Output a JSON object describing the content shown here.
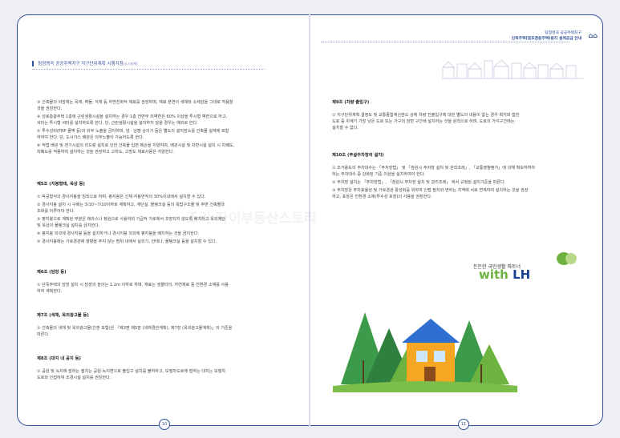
{
  "left_page": {
    "header_title": "탕정명곡 공공주택지구 지구단위계획 시행지침",
    "header_suffix": "(도시설계)",
    "page_number": "10",
    "items_top": [
      "③  건축물의 외장재는 목재, 벽돌, 석재 등 자연친화적 재료를 권장하며, 재료 본연의 색채와 소재감을 그대로 적용할",
      "      것을 권장한다.",
      "④  성로층층주택 1층에 근린생활시설을 설치하는 경우 1층 전면부 외벽면은 60% 이상을 투시형 벽면으로 하고,",
      "      셔터는 투시형 셔터를 설치하도록 한다. 단, 근린생활시설을 설치하지 않을 경우는 예외로 한다.",
      "⑤  투수성비(FRP 물벽 등)의 외부 노출을 금지하며, 넘 · 남향 상의가 등은 별도의 설치장소를 건축물 설계에 포함",
      "      하여야 한다. 단, 도시가스 배관은 외부노출이 가능하도록 한다.",
      "⑥  적법 배관 및 전기시설의 리드랑 설치로 인한 건축물 입면 훼손을 지양하며, 배관시설 및 차면시설 설치 시 차폐도,",
      "      차폐도를 적용하여 설치하는 것을 권장하고 고하도, 고명도 채료사용은 지양한다."
    ],
    "art5_title": "제5조 (지붕형태, 옥상 등)",
    "art5_items": [
      "①  박공형식의 경사지붕을 임직으로 하며, 평지붕은 신체 지붕면적의 30%이내에서 설치할 수 있다.",
      "②  경사지붕 설치 시 구배는 3/10~7/10이하로 계획하고, 계단실, 물탱크실 등의 옥탑구조물 및 주변 건축물과",
      "      조화를 이루어야 한다.",
      "③  평지붕으로 계획된 부분은 테라스나 정원으로 사용하되 가급적 가로에서 조망되지 않도록 배치하고 옥외계단",
      "      및 옥상의 물탱크실 설치를 금지한다.",
      "④  평지붕 외곽에 경사지붕 등을 설치하거나 경사지붕 외곽에 평지붕을 배치하는 것을 금지한다.",
      "⑤  경사지붕에는 가로경관에 영향을 주지 않는 범위 내에서 실외기, 안테나, 물탱크실 등을 설치할 수 있다."
    ],
    "art6_title": "제6조 (담장 등)",
    "art6_items": [
      "①  단독주택의 담장 설치 시 담장의 높이는 1.2m 이하로 하며, 재료는 생울타리, 자연재료 등 친환경 소재를 사용",
      "      하여 계획한다."
    ],
    "art7_title": "제7조 (색채, 옥외광고물 등)",
    "art7_items": [
      "①  건축물의 색채 및 옥외광고물(간판 포함)은 「제3편 제5장 (색채경관계획), 제7장 (옥외광고물계획)」의 기준을",
      "      따른다."
    ],
    "art8_title": "제8조 (대지 내 공지 등)",
    "art8_items": [
      "①  공원 및 녹지에 접하는 필지는 공원·녹지변으로 출입구 설치를 불허하고, 보행자도로에 접하는 대지는 보행자",
      "      도로와 인접하여 조경시설 설치를 권장한다."
    ]
  },
  "right_page": {
    "series_line1": "탕정명곡 공공주택지구",
    "series_line2": "단독주택(점포겸용주택)용지 설계공급 안내",
    "page_number": "11",
    "art9_title": "제9조 (차량 출입구)",
    "art9_items": [
      "①  지구단위계획 결정도 및 교통종합계산판도 상에 차량 진출입구에 대한 별도의 내용이 없는 경우 획지와 접한",
      "      도로 중 위계가 가장 낮은 도로 또는 가구의 장변 구간에 설치하는 것을 원칙으로 하며, 도로의 가각구간에는",
      "      설치할 수 없다."
    ],
    "art10_title": "제10조 (부설주차장의 설치)",
    "art10_items": [
      "①  조거용도의 주차대수는 「주차장법」 및 「창원시 주차장 설치 및 관리조례」, 「교통영향평가」에 의해 확보하여야",
      "      하는 주차대수 중 강화된 기준 이상을 설치하여야 한다.",
      "②  주차장 설치는 「주차장법」, 「창원시 주차장 설치 및 관리조례」 에서 규정된 설치기준을 따른다.",
      "③  주차장은 주차효율성 및 가로경관 활성화를 위하여 인접 필지와 면하는 지역에 서로 연계하여 설치하는 것을 권장",
      "      하고, 포장은 친환경 소재(투수성 포장)의 사용을 권장한다."
    ],
    "slogan": "든든한 국민생활 파트너",
    "logo_with": "with",
    "logo_lh": "LH"
  },
  "watermark_text": "조리 자이부동산스토리",
  "colors": {
    "brand_blue": "#2f4f9a",
    "lh_green": "#6cb33f",
    "lh_navy": "#1b3f94"
  },
  "icons": [
    "city-skyline-illustration",
    "house-tree-illustration"
  ]
}
